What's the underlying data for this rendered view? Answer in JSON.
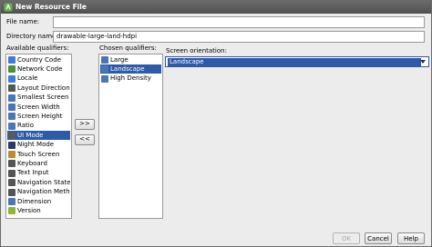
{
  "window": {
    "title": "New Resource File"
  },
  "form": {
    "file_name_label": "File name:",
    "file_name_value": "",
    "directory_name_label": "Directory name:",
    "directory_name_value": "drawable-large-land-hdpi"
  },
  "available": {
    "label": "Available qualifiers:",
    "items": [
      {
        "label": "Country Code",
        "icon": "globe-icon",
        "color": "#3b7dd8"
      },
      {
        "label": "Network Code",
        "icon": "network-icon",
        "color": "#4d8f3a"
      },
      {
        "label": "Locale",
        "icon": "globe-icon",
        "color": "#3b7dd8"
      },
      {
        "label": "Layout Direction",
        "icon": "layout-direction-icon",
        "color": "#555555"
      },
      {
        "label": "Smallest Screen Width",
        "icon": "screen-width-icon",
        "color": "#4a76b8"
      },
      {
        "label": "Screen Width",
        "icon": "screen-width-icon",
        "color": "#4a76b8"
      },
      {
        "label": "Screen Height",
        "icon": "screen-height-icon",
        "color": "#4a76b8"
      },
      {
        "label": "Ratio",
        "icon": "ratio-icon",
        "color": "#4a76b8"
      },
      {
        "label": "UI Mode",
        "icon": "ui-mode-icon",
        "color": "#5a5a5a",
        "selected": true
      },
      {
        "label": "Night Mode",
        "icon": "night-mode-icon",
        "color": "#2a3a6a"
      },
      {
        "label": "Touch Screen",
        "icon": "touch-icon",
        "color": "#c08a30"
      },
      {
        "label": "Keyboard",
        "icon": "keyboard-icon",
        "color": "#555555"
      },
      {
        "label": "Text Input",
        "icon": "text-input-icon",
        "color": "#555555"
      },
      {
        "label": "Navigation State",
        "icon": "navigation-icon",
        "color": "#555555"
      },
      {
        "label": "Navigation Method",
        "icon": "navigation-icon",
        "color": "#555555"
      },
      {
        "label": "Dimension",
        "icon": "dimension-icon",
        "color": "#4a76b8"
      },
      {
        "label": "Version",
        "icon": "android-icon",
        "color": "#8ab833"
      }
    ]
  },
  "transfer": {
    "add_label": ">>",
    "remove_label": "<<"
  },
  "chosen": {
    "label": "Chosen qualifiers:",
    "items": [
      {
        "label": "Large",
        "icon": "size-icon",
        "color": "#4a76b8"
      },
      {
        "label": "Landscape",
        "icon": "orientation-icon",
        "color": "#4a76b8",
        "selected": true
      },
      {
        "label": "High Density",
        "icon": "density-icon",
        "color": "#4a76b8"
      }
    ]
  },
  "orientation": {
    "label": "Screen orientation:",
    "value": "Landscape"
  },
  "footer": {
    "ok_label": "OK",
    "cancel_label": "Cancel",
    "help_label": "Help"
  },
  "colors": {
    "selection": "#2e5aa8",
    "titlebar": "#5a5a5a"
  }
}
